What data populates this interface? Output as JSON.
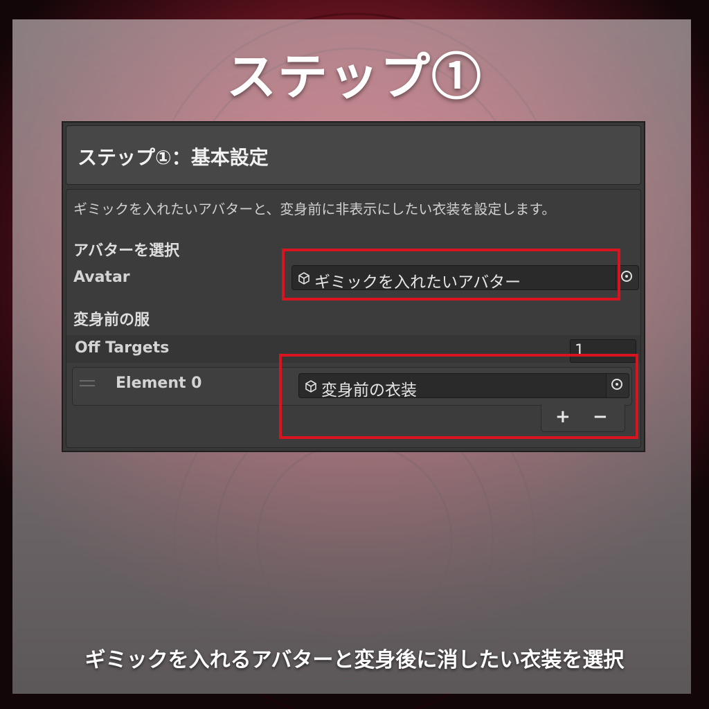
{
  "title": "ステップ①",
  "caption": "ギミックを入れるアバターと変身後に消したい衣装を選択",
  "colors": {
    "highlight": "#d8141e",
    "panel": "#383838",
    "background": "#8e1c2c"
  },
  "panel": {
    "header_label": "ステップ①：基本設定",
    "description": "ギミックを入れたいアバターと、変身前に非表示にしたい衣装を設定します。",
    "avatar_section": {
      "heading": "アバターを選択",
      "field_label": "Avatar",
      "field_value": "ギミックを入れたいアバター",
      "icon": "cube-icon",
      "picker_icon": "object-picker-icon"
    },
    "clothes_section": {
      "heading": "変身前の服",
      "list_label": "Off Targets",
      "list_size": "1",
      "elements": [
        {
          "label": "Element 0",
          "value": "変身前の衣装"
        }
      ],
      "add_label": "+",
      "remove_label": "−"
    }
  }
}
